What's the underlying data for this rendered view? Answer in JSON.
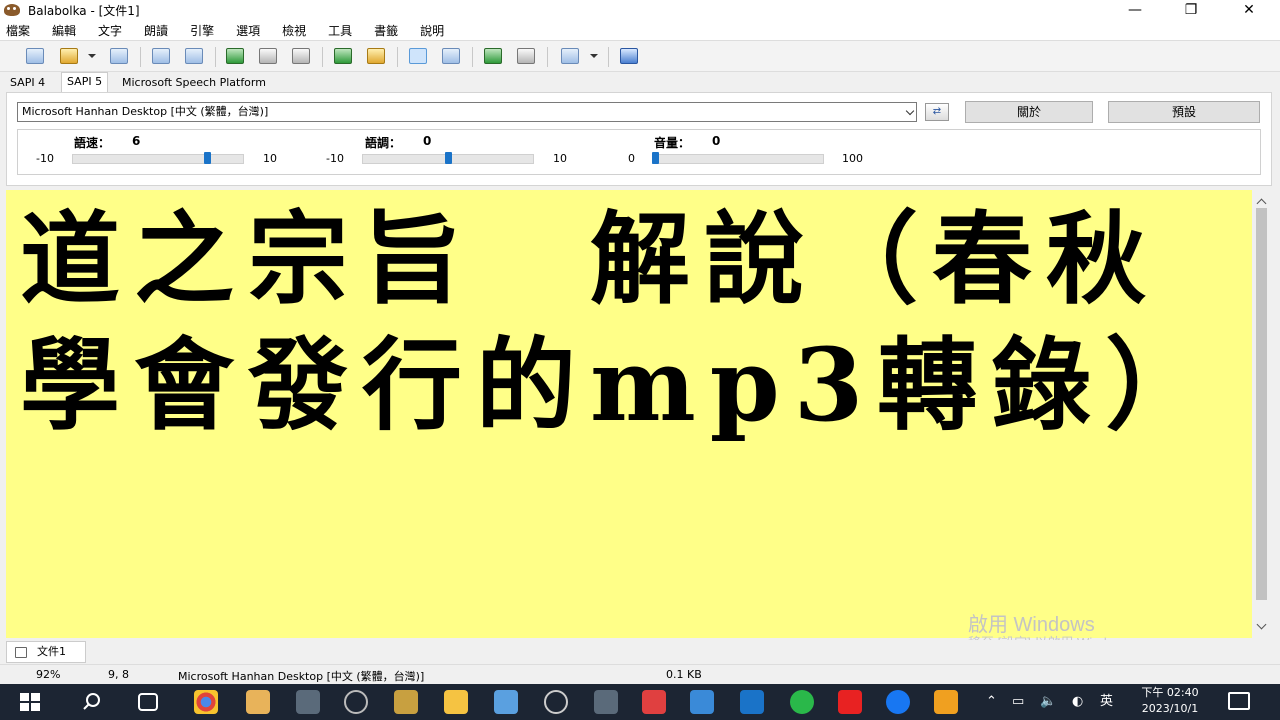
{
  "window": {
    "title": "Balabolka - [文件1]",
    "min": "—",
    "max": "❐",
    "close": "✕"
  },
  "menu": [
    "檔案",
    "編輯",
    "文字",
    "朗讀",
    "引擎",
    "選項",
    "檢視",
    "工具",
    "書籤",
    "說明"
  ],
  "engine_tabs": [
    {
      "label": "SAPI 4"
    },
    {
      "label": "SAPI 5",
      "selected": true
    },
    {
      "label": "Microsoft Speech Platform"
    }
  ],
  "voice": {
    "selected": "Microsoft Hanhan Desktop [中文 (繁體，台灣)]"
  },
  "buttons": {
    "about": "關於",
    "default": "預設"
  },
  "sliders": {
    "rate": {
      "label": "語速：",
      "value": "6",
      "min": "-10",
      "max": "10",
      "position": 0.8
    },
    "pitch": {
      "label": "語調：",
      "value": "0",
      "min": "-10",
      "max": "10",
      "position": 0.5
    },
    "volume": {
      "label": "音量：",
      "value": "0",
      "min": "0",
      "max": "100",
      "position": 0.0
    }
  },
  "editor": {
    "content": "道之宗旨　解說（春秋學會發行的mp3轉錄）",
    "background": "#ffff88"
  },
  "watermark": {
    "line1": "啟用 Windows",
    "line2": "移至 [設定] 以啟用 Windows。"
  },
  "doc_tab": {
    "label": "文件1"
  },
  "status": {
    "zoom": "92%",
    "position": "9,  8",
    "voice": "Microsoft Hanhan Desktop [中文 (繁體，台灣)]",
    "size": "0.1 KB"
  },
  "tray": {
    "lang": "英",
    "time": "下午 02:40",
    "date": "2023/10/1"
  },
  "colors": {
    "accent": "#1a73c8",
    "taskbar": "#1c2533",
    "editor_bg": "#ffff88"
  }
}
